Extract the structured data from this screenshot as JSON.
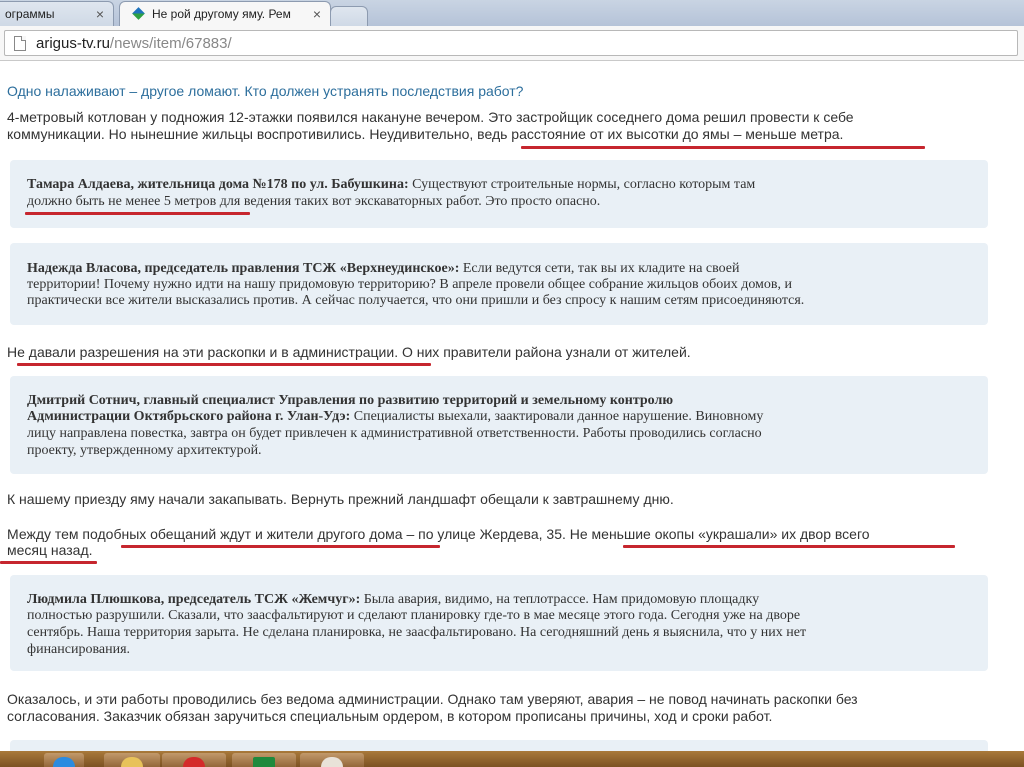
{
  "browser": {
    "tabs": [
      {
        "label": "ограммы",
        "close": "×"
      },
      {
        "label": "Не рой другому яму. Рем",
        "close": "×"
      }
    ],
    "url_host": "arigus-tv.ru",
    "url_path": "/news/item/67883/"
  },
  "article": {
    "heading": "Одно налаживают – другое ломают. Кто должен устранять последствия работ?",
    "p1_l1": "4-метровый котлован у подножия 12-этажки появился накануне вечером. Это застройщик соседнего дома решил провести к себе",
    "p1_l2": "коммуникации. Но нынешние жильцы воспротивились. Неудивительно, ведь расстояние от их высотки до ямы – меньше метра.",
    "q1_author": "Тамара Алдаева, жительница дома №178 по ул. Бабушкина:",
    "q1_l1": " Существуют строительные нормы, согласно которым там",
    "q1_l2": "должно быть не менее 5 метров для ведения таких вот экскаваторных работ. Это просто опасно.",
    "q2_author": "Надежда Власова, председатель правления ТСЖ «Верхнеудинское»:",
    "q2_l1": " Если ведутся сети, так вы их кладите на своей",
    "q2_l2": "территории! Почему нужно идти на нашу придомовую территорию? В апреле провели общее собрание жильцов обоих домов, и",
    "q2_l3": "практически все жители высказались против. А сейчас получается, что они пришли и без спросу к нашим сетям присоединяются.",
    "p2": "Не давали разрешения на эти раскопки и в администрации. О них правители района узнали от жителей.",
    "q3_author_l1": "Дмитрий Сотнич, главный специалист Управления по развитию территорий и земельному контролю",
    "q3_author_l2": "Администрации Октябрьского района г. Улан-Удэ:",
    "q3_l2": " Специалисты выехали, заактировали данное нарушение. Виновному",
    "q3_l3": "лицу направлена повестка, завтра он будет привлечен к административной ответственности. Работы проводились согласно",
    "q3_l4": "проекту, утвержденному архитектурой.",
    "p3": "К нашему приезду яму начали закапывать. Вернуть прежний ландшафт обещали к завтрашнему дню.",
    "p4_l1": "Между тем подобных обещаний ждут и жители другого дома – по улице Жердева, 35. Не меньшие окопы «украшали» их двор всего",
    "p4_l2": "месяц назад.",
    "q4_author": "Людмила Плюшкова, председатель ТСЖ «Жемчуг»:",
    "q4_l1": " Была авария, видимо, на теплотрассе. Нам придомовую площадку",
    "q4_l2": "полностью разрушили. Сказали, что заасфальтируют и сделают планировку где-то в мае месяце этого года. Сегодня уже на дворе",
    "q4_l3": "сентябрь. Наша территория зарыта. Не сделана планировка, не заасфальтировано. На сегодняшний день я выяснила, что у них нет",
    "q4_l4": "финансирования.",
    "p5_l1": "Оказалось, и эти работы проводились без ведома администрации. Однако там уверяют, авария – не повод начинать раскопки без",
    "p5_l2": "согласования. Заказчик обязан заручиться специальным ордером, в котором прописаны причины, ход и сроки работ."
  },
  "colors": {
    "heading": "#2c6e9c",
    "quote_bg": "#e9f0f6",
    "underline": "#c6262e",
    "taskbar": "#8b5e2c"
  },
  "taskbar": {
    "icons": [
      "ie-icon",
      "folder-icon",
      "opera-icon",
      "excel-icon",
      "powerpoint-icon"
    ]
  }
}
